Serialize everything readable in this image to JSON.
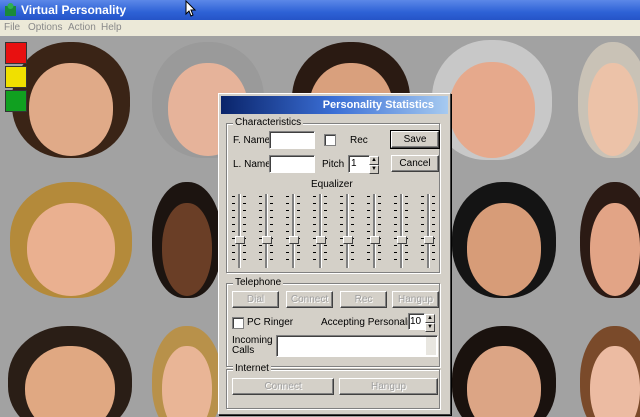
{
  "app": {
    "title": "Virtual Personality",
    "menu": [
      "File",
      "Options",
      "Action",
      "Help"
    ]
  },
  "traffic_light_colors": [
    "#e81010",
    "#f0e000",
    "#10a020"
  ],
  "dialog": {
    "title": "Personality Statistics",
    "characteristics": {
      "group_label": "Characteristics",
      "first_name_label": "F. Name",
      "first_name_value": "",
      "last_name_label": "L. Name",
      "last_name_value": "",
      "rec_label": "Rec",
      "rec_checked": false,
      "pitch_label": "Pitch",
      "pitch_value": "1",
      "save_label": "Save",
      "cancel_label": "Cancel",
      "equalizer_label": "Equalizer",
      "equalizer_levels": [
        0.62,
        0.62,
        0.62,
        0.62,
        0.62,
        0.62,
        0.62,
        0.62
      ]
    },
    "telephone": {
      "group_label": "Telephone",
      "dial_label": "Dial",
      "connect_label": "Connect",
      "rec_label": "Rec",
      "hangup_label": "Hangup",
      "pc_ringer_label": "PC Ringer",
      "pc_ringer_checked": false,
      "accepting_label": "Accepting Personality",
      "accepting_value": "10",
      "incoming_label_1": "Incoming",
      "incoming_label_2": "Calls"
    },
    "internet": {
      "group_label": "Internet",
      "connect_label": "Connect",
      "hangup_label": "Hangup"
    }
  }
}
